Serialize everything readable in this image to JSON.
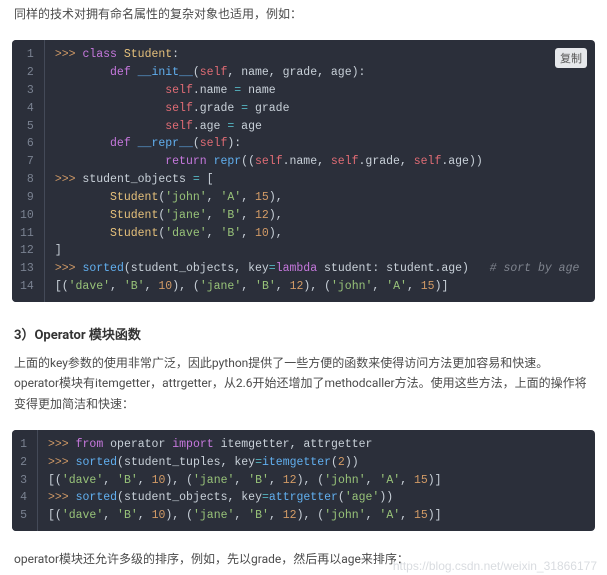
{
  "intro_para": "同样的技术对拥有命名属性的复杂对象也适用，例如：",
  "copy_button_label": "复制",
  "code_block_1": {
    "lines_html": [
      "<span class='tk-prompt'>&gt;&gt;&gt;</span> <span class='tk-kw'>class</span> <span class='tk-cls'>Student</span>:",
      "        <span class='tk-kw'>def</span> <span class='tk-fn'>__init__</span>(<span class='tk-self'>self</span>, name, grade, age):",
      "                <span class='tk-self'>self</span>.name <span class='tk-op'>=</span> name",
      "                <span class='tk-self'>self</span>.grade <span class='tk-op'>=</span> grade",
      "                <span class='tk-self'>self</span>.age <span class='tk-op'>=</span> age",
      "        <span class='tk-kw'>def</span> <span class='tk-fn'>__repr__</span>(<span class='tk-self'>self</span>):",
      "                <span class='tk-kw'>return</span> <span class='tk-fn'>repr</span>((<span class='tk-self'>self</span>.name, <span class='tk-self'>self</span>.grade, <span class='tk-self'>self</span>.age))",
      "<span class='tk-prompt'>&gt;&gt;&gt;</span> student_objects <span class='tk-op'>=</span> [",
      "        <span class='tk-cls'>Student</span>(<span class='tk-str'>'john'</span>, <span class='tk-str'>'A'</span>, <span class='tk-num'>15</span>),",
      "        <span class='tk-cls'>Student</span>(<span class='tk-str'>'jane'</span>, <span class='tk-str'>'B'</span>, <span class='tk-num'>12</span>),",
      "        <span class='tk-cls'>Student</span>(<span class='tk-str'>'dave'</span>, <span class='tk-str'>'B'</span>, <span class='tk-num'>10</span>),",
      "]",
      "<span class='tk-prompt'>&gt;&gt;&gt;</span> <span class='tk-fn'>sorted</span>(student_objects, key<span class='tk-op'>=</span><span class='tk-kw'>lambda</span> student: student.age)   <span class='tk-comment'># sort by age</span>",
      "[(<span class='tk-str'>'dave'</span>, <span class='tk-str'>'B'</span>, <span class='tk-num'>10</span>), (<span class='tk-str'>'jane'</span>, <span class='tk-str'>'B'</span>, <span class='tk-num'>12</span>), (<span class='tk-str'>'john'</span>, <span class='tk-str'>'A'</span>, <span class='tk-num'>15</span>)]"
    ]
  },
  "section_title": "3）Operator 模块函数",
  "middle_para": "上面的key参数的使用非常广泛，因此python提供了一些方便的函数来使得访问方法更加容易和快速。operator模块有itemgetter，attrgetter，从2.6开始还增加了methodcaller方法。使用这些方法，上面的操作将变得更加简洁和快速：",
  "code_block_2": {
    "lines_html": [
      "<span class='tk-prompt'>&gt;&gt;&gt;</span> <span class='tk-kw'>from</span> operator <span class='tk-kw'>import</span> itemgetter, attrgetter",
      "<span class='tk-prompt'>&gt;&gt;&gt;</span> <span class='tk-fn'>sorted</span>(student_tuples, key<span class='tk-op'>=</span><span class='tk-fn'>itemgetter</span>(<span class='tk-num'>2</span>))",
      "[(<span class='tk-str'>'dave'</span>, <span class='tk-str'>'B'</span>, <span class='tk-num'>10</span>), (<span class='tk-str'>'jane'</span>, <span class='tk-str'>'B'</span>, <span class='tk-num'>12</span>), (<span class='tk-str'>'john'</span>, <span class='tk-str'>'A'</span>, <span class='tk-num'>15</span>)]",
      "<span class='tk-prompt'>&gt;&gt;&gt;</span> <span class='tk-fn'>sorted</span>(student_objects, key<span class='tk-op'>=</span><span class='tk-fn'>attrgetter</span>(<span class='tk-str'>'age'</span>))",
      "[(<span class='tk-str'>'dave'</span>, <span class='tk-str'>'B'</span>, <span class='tk-num'>10</span>), (<span class='tk-str'>'jane'</span>, <span class='tk-str'>'B'</span>, <span class='tk-num'>12</span>), (<span class='tk-str'>'john'</span>, <span class='tk-str'>'A'</span>, <span class='tk-num'>15</span>)]"
    ]
  },
  "bottom_para": "operator模块还允许多级的排序，例如，先以grade，然后再以age来排序：",
  "watermark": "https://blog.csdn.net/weixin_31866177"
}
